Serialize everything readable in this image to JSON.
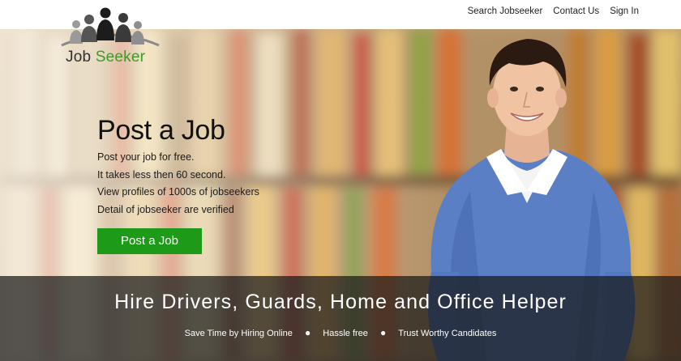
{
  "nav": {
    "items": [
      "Search Jobseeker",
      "Contact Us",
      "Sign In"
    ]
  },
  "logo": {
    "word1": "Job",
    "word2": "Seeker"
  },
  "hero": {
    "title": "Post a Job",
    "lines": [
      "Post your job for free.",
      "It takes less then 60 second.",
      "View profiles of 1000s of jobseekers",
      "Detail of jobseeker are verified"
    ],
    "button_label": "Post a Job"
  },
  "band": {
    "title": "Hire Drivers, Guards, Home and Office Helper",
    "points": [
      "Save Time by Hiring Online",
      "Hassle free",
      "Trust Worthy Candidates"
    ],
    "separator": "●"
  },
  "colors": {
    "brand_green": "#3f9a2b",
    "button_green": "#1e9a19",
    "band_overlay": "#191919"
  }
}
